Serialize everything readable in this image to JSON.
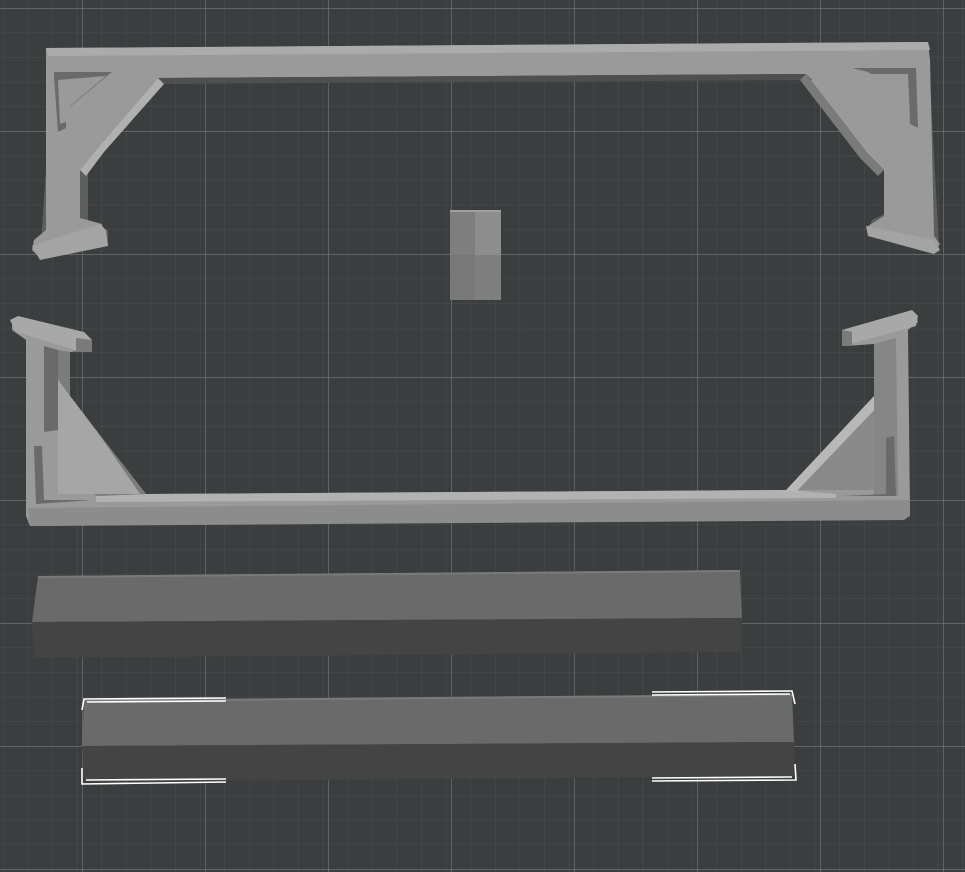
{
  "scene": {
    "kind": "3d-slicer-build-plate",
    "colors": {
      "plate_background": "#3b3e3f",
      "grid_minor": "#4a4e4f",
      "grid_major": "#6c7273",
      "part_light": "#9a9a9a",
      "part_mid": "#8a8a8a",
      "part_shadow": "#5e5e5e",
      "bar_top": "#6a6a6a",
      "bar_front": "#444444",
      "selection_outline": "#ffffff"
    },
    "objects": [
      {
        "name": "top-frame-bracket",
        "selected": false
      },
      {
        "name": "small-block",
        "selected": false
      },
      {
        "name": "bottom-frame-bracket",
        "selected": false
      },
      {
        "name": "long-bar-upper",
        "selected": false
      },
      {
        "name": "long-bar-lower",
        "selected": true
      }
    ]
  }
}
